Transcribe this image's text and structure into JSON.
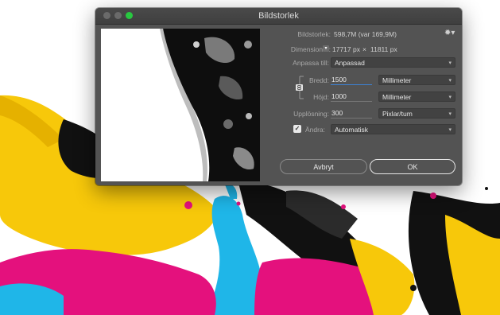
{
  "window": {
    "title": "Bildstorlek"
  },
  "info": {
    "size_label": "Bildstorlek:",
    "size_value": "598,7M (var 169,9M)",
    "dimensions_label": "Dimensioner:",
    "dimensions_width": "17717 px",
    "dimensions_separator": "×",
    "dimensions_height": "11811 px"
  },
  "fit": {
    "label": "Anpassa till:",
    "value": "Anpassad"
  },
  "width": {
    "label": "Bredd:",
    "value": "1500",
    "unit": "Millimeter"
  },
  "height": {
    "label": "Höjd:",
    "value": "1000",
    "unit": "Millimeter"
  },
  "resolution": {
    "label": "Upplösning:",
    "value": "300",
    "unit": "Pixlar/tum"
  },
  "resample": {
    "label": "Ändra:",
    "checked": true,
    "value": "Automatisk"
  },
  "buttons": {
    "cancel": "Avbryt",
    "ok": "OK"
  },
  "colors": {
    "cyan": "#1fb6e8",
    "magenta": "#e4117d",
    "yellow": "#f7c80a",
    "black": "#111111",
    "dialog_bg": "#535353",
    "accent_green": "#28c840"
  }
}
